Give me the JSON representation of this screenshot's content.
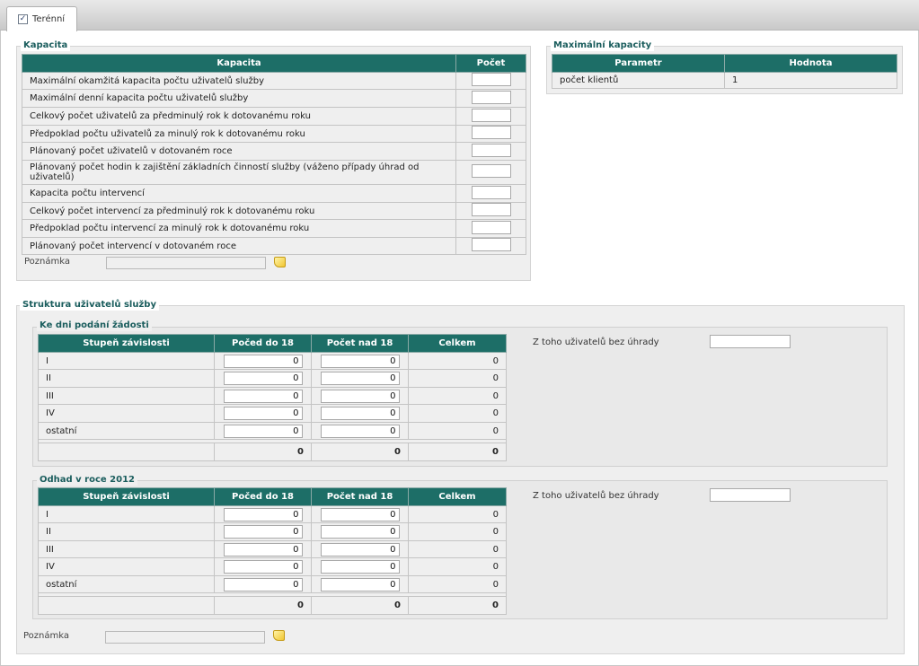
{
  "tab": {
    "label": "Terénní",
    "checked": "✓"
  },
  "kapacita": {
    "legend": "Kapacita",
    "headers": [
      "Kapacita",
      "Počet"
    ],
    "rows": [
      "Maximální okamžitá kapacita počtu uživatelů služby",
      "Maximální denní kapacita počtu uživatelů služby",
      "Celkový počet uživatelů za předminulý rok k dotovanému roku",
      "Předpoklad počtu uživatelů za minulý rok k dotovanému roku",
      "Plánovaný počet uživatelů v dotovaném roce",
      "Plánovaný počet hodin k zajištění základních činností služby (váženo případy úhrad od uživatelů)",
      "Kapacita počtu intervencí",
      "Celkový počet intervencí za předminulý rok k dotovanému roku",
      "Předpoklad počtu intervencí za minulý rok k dotovanému roku",
      "Plánovaný počet intervencí v dotovaném roce"
    ],
    "note_label": "Poznámka"
  },
  "max_kapacity": {
    "legend": "Maximální kapacity",
    "headers": [
      "Parametr",
      "Hodnota"
    ],
    "rows": [
      {
        "param": "počet klientů",
        "value": "1"
      }
    ]
  },
  "struktura": {
    "legend": "Struktura uživatelů služby",
    "note_label": "Poznámka",
    "sections": [
      {
        "legend": "Ke dni podání žádosti",
        "headers": [
          "Stupeň závislosti",
          "Počed do 18",
          "Počet nad 18",
          "Celkem"
        ],
        "rows": [
          {
            "level": "I",
            "under": "0",
            "over": "0",
            "total": "0"
          },
          {
            "level": "II",
            "under": "0",
            "over": "0",
            "total": "0"
          },
          {
            "level": "III",
            "under": "0",
            "over": "0",
            "total": "0"
          },
          {
            "level": "IV",
            "under": "0",
            "over": "0",
            "total": "0"
          },
          {
            "level": "ostatní",
            "under": "0",
            "over": "0",
            "total": "0"
          }
        ],
        "totals": {
          "under": "0",
          "over": "0",
          "total": "0"
        },
        "side_label": "Z toho uživatelů bez úhrady"
      },
      {
        "legend": "Odhad v roce 2012",
        "headers": [
          "Stupeň závislosti",
          "Počed do 18",
          "Počet nad 18",
          "Celkem"
        ],
        "rows": [
          {
            "level": "I",
            "under": "0",
            "over": "0",
            "total": "0"
          },
          {
            "level": "II",
            "under": "0",
            "over": "0",
            "total": "0"
          },
          {
            "level": "III",
            "under": "0",
            "over": "0",
            "total": "0"
          },
          {
            "level": "IV",
            "under": "0",
            "over": "0",
            "total": "0"
          },
          {
            "level": "ostatní",
            "under": "0",
            "over": "0",
            "total": "0"
          }
        ],
        "totals": {
          "under": "0",
          "over": "0",
          "total": "0"
        },
        "side_label": "Z toho uživatelů bez úhrady"
      }
    ]
  },
  "colors": {
    "header_bg": "#1d6e67",
    "legend_text": "#1a5d5d",
    "panel_bg": "#efefef"
  }
}
